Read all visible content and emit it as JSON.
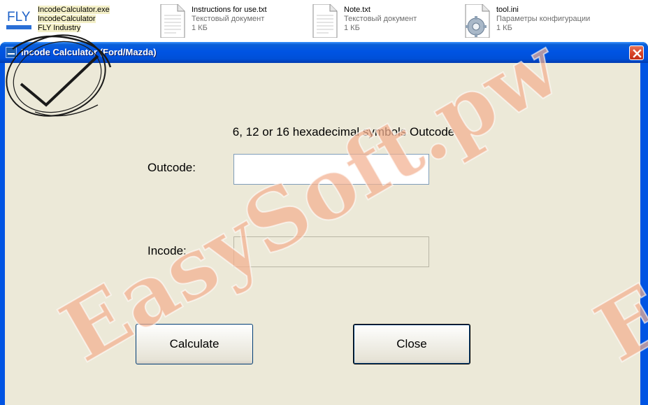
{
  "explorer": {
    "files": [
      {
        "name": "IncodeCalculator.exe",
        "line2": "IncodeCalculator",
        "line3": "FLY Industry",
        "icon": "fly-app-icon",
        "selected": true
      },
      {
        "name": "Instructions for use.txt",
        "line2": "Текстовый документ",
        "line3": "1 КБ",
        "icon": "text-document-icon"
      },
      {
        "name": "Note.txt",
        "line2": "Текстовый документ",
        "line3": "1 КБ",
        "icon": "text-document-icon"
      },
      {
        "name": "tool.ini",
        "line2": "Параметры конфигурации",
        "line3": "1 КБ",
        "icon": "config-gear-icon"
      }
    ],
    "fly_logo_text": "FLY"
  },
  "dialog": {
    "title": "Incode Calculator (Ford/Mazda)",
    "instruction": "6, 12 or 16 hexadecimal symbols Outcode",
    "outcode_label": "Outcode:",
    "outcode_value": "",
    "incode_label": "Incode:",
    "incode_value": "",
    "calculate_label": "Calculate",
    "close_label": "Close"
  },
  "watermark": {
    "text": "EasySoft.pw",
    "edge_text": "E",
    "color": "#f3b090"
  },
  "colors": {
    "titlebar": "#0054e3",
    "dialog_bg": "#ece9d8",
    "close_button": "#d9452a"
  }
}
